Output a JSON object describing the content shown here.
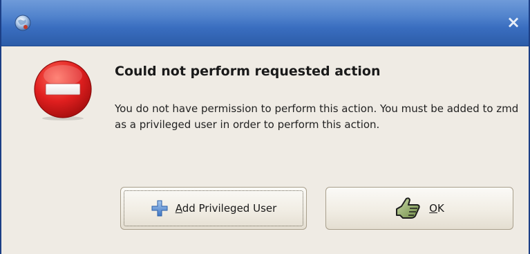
{
  "window": {
    "close_glyph": "×"
  },
  "dialog": {
    "heading": "Could not perform requested action",
    "message": "You do not have permission to perform this action.  You must be added to zmd as a privileged user in order to perform this action.",
    "icon": "error-no-entry-icon"
  },
  "buttons": {
    "add_privileged_user": {
      "mnemonic": "A",
      "rest": "dd Privileged User",
      "icon": "plus-icon"
    },
    "ok": {
      "mnemonic": "O",
      "rest": "K",
      "icon": "thumbs-up-icon"
    }
  },
  "colors": {
    "titlebar": "#4a7cc8",
    "error_red": "#d81e1e",
    "dialog_bg": "#efebe4"
  }
}
